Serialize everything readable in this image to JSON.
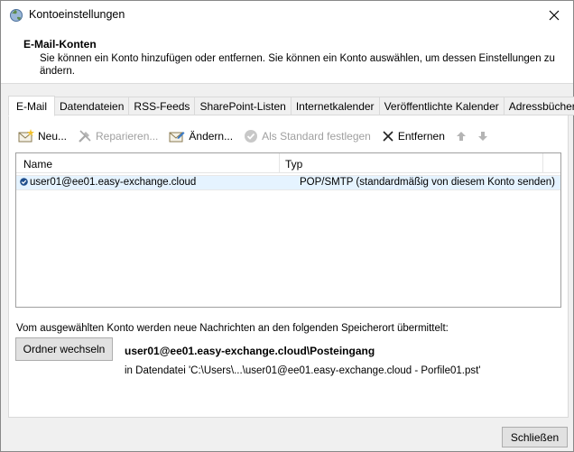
{
  "window": {
    "title": "Kontoeinstellungen"
  },
  "header": {
    "title": "E-Mail-Konten",
    "description": "Sie können ein Konto hinzufügen oder entfernen. Sie können ein Konto auswählen, um dessen Einstellungen zu ändern."
  },
  "tabs": [
    {
      "label": "E-Mail",
      "active": true
    },
    {
      "label": "Datendateien"
    },
    {
      "label": "RSS-Feeds"
    },
    {
      "label": "SharePoint-Listen"
    },
    {
      "label": "Internetkalender"
    },
    {
      "label": "Veröffentlichte Kalender"
    },
    {
      "label": "Adressbücher"
    }
  ],
  "toolbar": {
    "new_label": "Neu...",
    "repair_label": "Reparieren...",
    "change_label": "Ändern...",
    "default_label": "Als Standard festlegen",
    "remove_label": "Entfernen"
  },
  "list": {
    "columns": {
      "name": "Name",
      "type": "Typ"
    },
    "rows": [
      {
        "name": "user01@ee01.easy-exchange.cloud",
        "type": "POP/SMTP (standardmäßig von diesem Konto senden)"
      }
    ]
  },
  "delivery": {
    "info": "Vom ausgewählten Konto werden neue Nachrichten an den folgenden Speicherort übermittelt:",
    "change_folder_label": "Ordner wechseln",
    "folder_path": "user01@ee01.easy-exchange.cloud\\Posteingang",
    "data_file": "in Datendatei 'C:\\Users\\...\\user01@ee01.easy-exchange.cloud - Porfile01.pst'"
  },
  "footer": {
    "close_label": "Schließen"
  },
  "colors": {
    "selection": "#e5f3ff",
    "check": "#1f4e8c",
    "button_face": "#e1e1e1"
  }
}
